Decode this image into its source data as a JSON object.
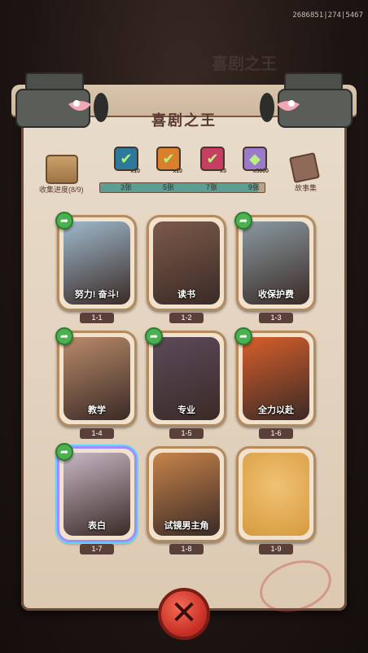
{
  "debug_text": "2686851|274|5467",
  "title": "喜剧之王",
  "collection": {
    "label": "收集进度(8/9)",
    "story_label": "故事集",
    "progress_fraction": 0.96
  },
  "milestones": [
    {
      "label": "3张",
      "count": "x10",
      "color": "#2b7a9b"
    },
    {
      "label": "5张",
      "count": "x10",
      "color": "#d8802c"
    },
    {
      "label": "7张",
      "count": "x5",
      "color": "#c63f63"
    },
    {
      "label": "9张",
      "count": "x5000",
      "color": "#9c7acb"
    }
  ],
  "cards": [
    {
      "id": "1-1",
      "caption": "努力! 奋斗!",
      "shared": true,
      "bg": "#9fb9cc"
    },
    {
      "id": "1-2",
      "caption": "读书",
      "shared": false,
      "bg": "#7c5a4a"
    },
    {
      "id": "1-3",
      "caption": "收保护费",
      "shared": true,
      "bg": "#8a9aa0"
    },
    {
      "id": "1-4",
      "caption": "教学",
      "shared": true,
      "bg": "#b98a6a"
    },
    {
      "id": "1-5",
      "caption": "专业",
      "shared": true,
      "bg": "#5c4a5a"
    },
    {
      "id": "1-6",
      "caption": "全力以赴",
      "shared": true,
      "bg": "#d65e2b"
    },
    {
      "id": "1-7",
      "caption": "表白",
      "shared": true,
      "bg": "#c7b7c4"
    },
    {
      "id": "1-8",
      "caption": "试镜男主角",
      "shared": false,
      "bg": "#c7834a"
    },
    {
      "id": "1-9",
      "caption": "",
      "shared": false,
      "bg": "#e0a44f",
      "locked": true
    }
  ],
  "icons": {
    "share": "share-arrow-icon",
    "close": "close-x-icon",
    "check": "checkmark-icon"
  }
}
